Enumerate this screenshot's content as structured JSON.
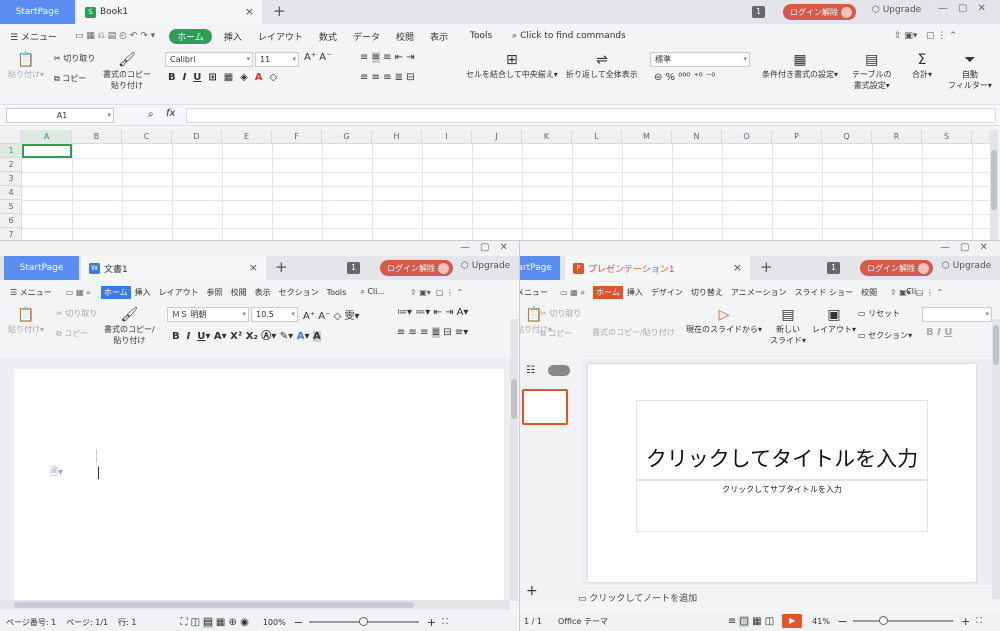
{
  "sheet": {
    "tabs": {
      "start": "StartPage",
      "doc": "Book1",
      "doc_icon": "S",
      "plus": "+"
    },
    "badge": "1",
    "login": "ログイン解除",
    "upgrade": "Upgrade",
    "menu": [
      "メニュー",
      "ホーム",
      "挿入",
      "レイアウト",
      "数式",
      "データ",
      "校閲",
      "表示",
      "Tools"
    ],
    "search": "Click to find commands",
    "ribbon": {
      "paste": "貼り付け",
      "cut": "切り取り",
      "copy": "コピー",
      "format_copy_1": "書式のコピー",
      "format_copy_2": "貼り付け",
      "font": "Calibri",
      "size": "11",
      "merge": "セルを結合して中央揃え",
      "wrap": "折り返して全体表示",
      "number_format": "標準",
      "cond_format": "条件付き書式の設定",
      "table_style_1": "テーブルの",
      "table_style_2": "書式設定",
      "sum": "合計",
      "filter_1": "自動",
      "filter_2": "フィルター"
    },
    "cell_ref": "A1",
    "fx": "fx",
    "columns": [
      "A",
      "B",
      "C",
      "D",
      "E",
      "F",
      "G",
      "H",
      "I",
      "J",
      "K",
      "L",
      "M",
      "N",
      "O",
      "P",
      "Q",
      "R",
      "S"
    ],
    "rows": [
      "1",
      "2",
      "3",
      "4",
      "5",
      "6",
      "7"
    ]
  },
  "writer": {
    "tabs": {
      "start": "StartPage",
      "doc": "文書1",
      "doc_icon": "W",
      "plus": "+"
    },
    "badge": "1",
    "login": "ログイン解除",
    "upgrade": "Upgrade",
    "menu": [
      "メニュー",
      "ホーム",
      "挿入",
      "レイアウト",
      "参照",
      "校閲",
      "表示",
      "セクション",
      "Tools"
    ],
    "search": "Cli...",
    "ribbon": {
      "paste": "貼り付け",
      "cut": "切り取り",
      "copy": "コピー",
      "format_copy_1": "書式のコピー/",
      "format_copy_2": "貼り付け",
      "font": "ＭＳ 明朝",
      "size": "10.5"
    },
    "status": {
      "page_no": "ページ番号: 1",
      "pages": "ページ: 1/1",
      "line": "行: 1",
      "zoom": "100%"
    }
  },
  "slides": {
    "tabs": {
      "start": "StartPage",
      "doc": "プレゼンテーション1",
      "doc_icon": "P",
      "plus": "+"
    },
    "badge": "1",
    "login": "ログイン解除",
    "upgrade": "Upgrade",
    "menu": [
      "メニュー",
      "ホーム",
      "挿入",
      "デザイン",
      "切り替え",
      "アニメーション",
      "スライド ショー",
      "校閲"
    ],
    "search": "Cli...",
    "ribbon": {
      "paste": "貼り付け",
      "cut": "切り取り",
      "copy": "コピー",
      "format_copy": "書式のコピー/貼り付け",
      "from_current": "現在のスライドから",
      "new_slide_1": "新しい",
      "new_slide_2": "スライド",
      "layout": "レイアウト",
      "reset": "リセット",
      "section": "セクション"
    },
    "title_placeholder": "クリックしてタイトルを入力",
    "subtitle_placeholder": "クリックしてサブタイトルを入力",
    "notes": "クリックしてノートを追加",
    "status": {
      "slide": "1 / 1",
      "theme": "Office テーマ",
      "zoom": "41%"
    }
  }
}
